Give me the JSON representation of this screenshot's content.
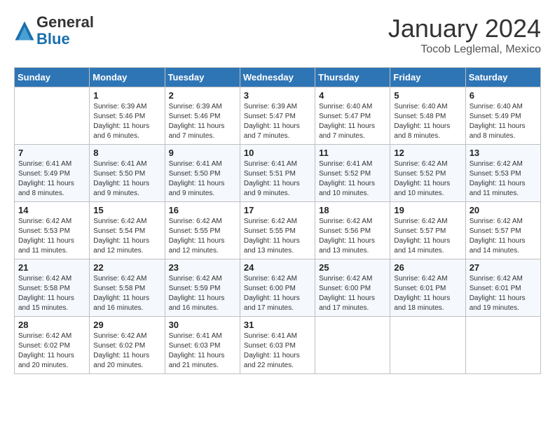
{
  "logo": {
    "general": "General",
    "blue": "Blue"
  },
  "title": "January 2024",
  "location": "Tocob Leglemal, Mexico",
  "days_of_week": [
    "Sunday",
    "Monday",
    "Tuesday",
    "Wednesday",
    "Thursday",
    "Friday",
    "Saturday"
  ],
  "weeks": [
    [
      {
        "day": "",
        "info": ""
      },
      {
        "day": "1",
        "info": "Sunrise: 6:39 AM\nSunset: 5:46 PM\nDaylight: 11 hours\nand 6 minutes."
      },
      {
        "day": "2",
        "info": "Sunrise: 6:39 AM\nSunset: 5:46 PM\nDaylight: 11 hours\nand 7 minutes."
      },
      {
        "day": "3",
        "info": "Sunrise: 6:39 AM\nSunset: 5:47 PM\nDaylight: 11 hours\nand 7 minutes."
      },
      {
        "day": "4",
        "info": "Sunrise: 6:40 AM\nSunset: 5:47 PM\nDaylight: 11 hours\nand 7 minutes."
      },
      {
        "day": "5",
        "info": "Sunrise: 6:40 AM\nSunset: 5:48 PM\nDaylight: 11 hours\nand 8 minutes."
      },
      {
        "day": "6",
        "info": "Sunrise: 6:40 AM\nSunset: 5:49 PM\nDaylight: 11 hours\nand 8 minutes."
      }
    ],
    [
      {
        "day": "7",
        "info": "Sunrise: 6:41 AM\nSunset: 5:49 PM\nDaylight: 11 hours\nand 8 minutes."
      },
      {
        "day": "8",
        "info": "Sunrise: 6:41 AM\nSunset: 5:50 PM\nDaylight: 11 hours\nand 9 minutes."
      },
      {
        "day": "9",
        "info": "Sunrise: 6:41 AM\nSunset: 5:50 PM\nDaylight: 11 hours\nand 9 minutes."
      },
      {
        "day": "10",
        "info": "Sunrise: 6:41 AM\nSunset: 5:51 PM\nDaylight: 11 hours\nand 9 minutes."
      },
      {
        "day": "11",
        "info": "Sunrise: 6:41 AM\nSunset: 5:52 PM\nDaylight: 11 hours\nand 10 minutes."
      },
      {
        "day": "12",
        "info": "Sunrise: 6:42 AM\nSunset: 5:52 PM\nDaylight: 11 hours\nand 10 minutes."
      },
      {
        "day": "13",
        "info": "Sunrise: 6:42 AM\nSunset: 5:53 PM\nDaylight: 11 hours\nand 11 minutes."
      }
    ],
    [
      {
        "day": "14",
        "info": "Sunrise: 6:42 AM\nSunset: 5:53 PM\nDaylight: 11 hours\nand 11 minutes."
      },
      {
        "day": "15",
        "info": "Sunrise: 6:42 AM\nSunset: 5:54 PM\nDaylight: 11 hours\nand 12 minutes."
      },
      {
        "day": "16",
        "info": "Sunrise: 6:42 AM\nSunset: 5:55 PM\nDaylight: 11 hours\nand 12 minutes."
      },
      {
        "day": "17",
        "info": "Sunrise: 6:42 AM\nSunset: 5:55 PM\nDaylight: 11 hours\nand 13 minutes."
      },
      {
        "day": "18",
        "info": "Sunrise: 6:42 AM\nSunset: 5:56 PM\nDaylight: 11 hours\nand 13 minutes."
      },
      {
        "day": "19",
        "info": "Sunrise: 6:42 AM\nSunset: 5:57 PM\nDaylight: 11 hours\nand 14 minutes."
      },
      {
        "day": "20",
        "info": "Sunrise: 6:42 AM\nSunset: 5:57 PM\nDaylight: 11 hours\nand 14 minutes."
      }
    ],
    [
      {
        "day": "21",
        "info": "Sunrise: 6:42 AM\nSunset: 5:58 PM\nDaylight: 11 hours\nand 15 minutes."
      },
      {
        "day": "22",
        "info": "Sunrise: 6:42 AM\nSunset: 5:58 PM\nDaylight: 11 hours\nand 16 minutes."
      },
      {
        "day": "23",
        "info": "Sunrise: 6:42 AM\nSunset: 5:59 PM\nDaylight: 11 hours\nand 16 minutes."
      },
      {
        "day": "24",
        "info": "Sunrise: 6:42 AM\nSunset: 6:00 PM\nDaylight: 11 hours\nand 17 minutes."
      },
      {
        "day": "25",
        "info": "Sunrise: 6:42 AM\nSunset: 6:00 PM\nDaylight: 11 hours\nand 17 minutes."
      },
      {
        "day": "26",
        "info": "Sunrise: 6:42 AM\nSunset: 6:01 PM\nDaylight: 11 hours\nand 18 minutes."
      },
      {
        "day": "27",
        "info": "Sunrise: 6:42 AM\nSunset: 6:01 PM\nDaylight: 11 hours\nand 19 minutes."
      }
    ],
    [
      {
        "day": "28",
        "info": "Sunrise: 6:42 AM\nSunset: 6:02 PM\nDaylight: 11 hours\nand 20 minutes."
      },
      {
        "day": "29",
        "info": "Sunrise: 6:42 AM\nSunset: 6:02 PM\nDaylight: 11 hours\nand 20 minutes."
      },
      {
        "day": "30",
        "info": "Sunrise: 6:41 AM\nSunset: 6:03 PM\nDaylight: 11 hours\nand 21 minutes."
      },
      {
        "day": "31",
        "info": "Sunrise: 6:41 AM\nSunset: 6:03 PM\nDaylight: 11 hours\nand 22 minutes."
      },
      {
        "day": "",
        "info": ""
      },
      {
        "day": "",
        "info": ""
      },
      {
        "day": "",
        "info": ""
      }
    ]
  ]
}
